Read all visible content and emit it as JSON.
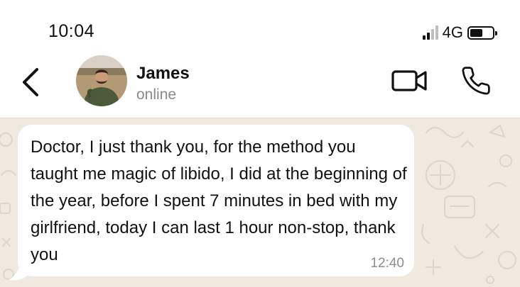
{
  "status_bar": {
    "time": "10:04",
    "network": "4G",
    "signal_icon": "signal-bars-icon",
    "battery_icon": "battery-icon",
    "battery_level": 0.5
  },
  "header": {
    "back_icon": "chevron-left-icon",
    "contact_name": "James",
    "presence": "online",
    "video_icon": "video-camera-icon",
    "call_icon": "phone-icon"
  },
  "chat": {
    "wallpaper_color": "#efe9df",
    "messages": [
      {
        "direction": "incoming",
        "text": "Doctor, I just thank you, for the method you taught me magic of libido, I did at the beginning of the year, before I spent 7 minutes in bed with my girlfriend, today I can last 1 hour non-stop, thank you",
        "time": "12:40"
      }
    ]
  }
}
